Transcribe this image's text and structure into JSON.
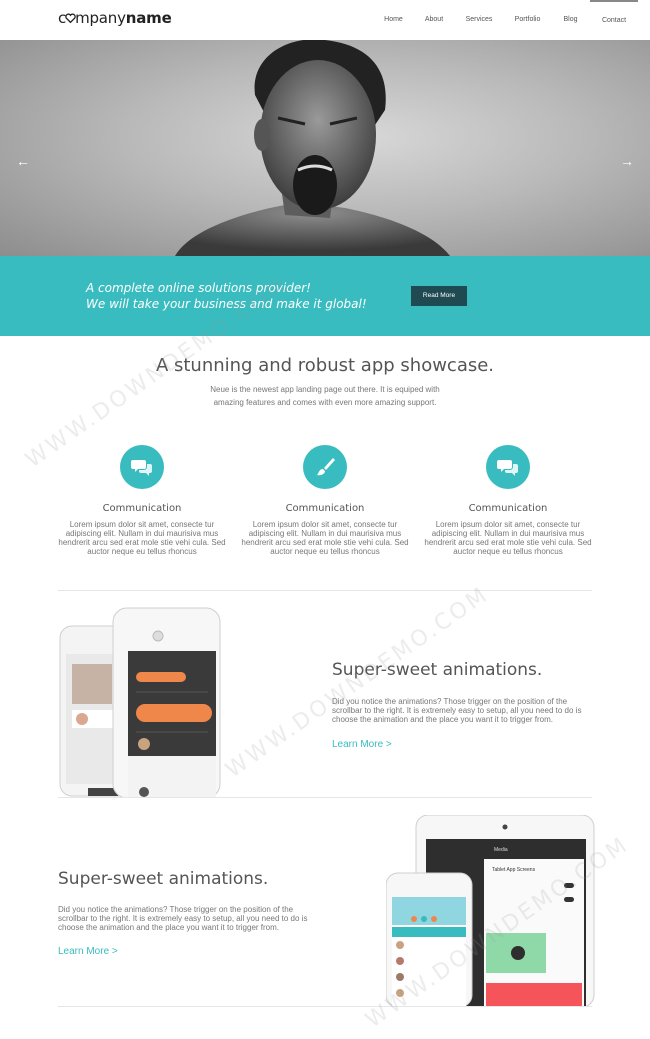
{
  "header": {
    "logo": {
      "prefix": "c",
      "middle": "mpany",
      "bold": "name"
    },
    "nav": [
      {
        "label": "Home"
      },
      {
        "label": "About"
      },
      {
        "label": "Services"
      },
      {
        "label": "Portfolio"
      },
      {
        "label": "Blog"
      },
      {
        "label": "Contact"
      }
    ]
  },
  "hero": {
    "prev_icon": "arrow-left-icon",
    "next_icon": "arrow-right-icon"
  },
  "banner": {
    "line1": "A complete online solutions provider!",
    "line2": "We will take your business and make it global!",
    "button": "Read More"
  },
  "showcase": {
    "title": "A stunning and robust app showcase.",
    "description": "Neue is the newest app landing page out there. It is equiped with amazing features and comes with even more amazing support."
  },
  "features": [
    {
      "icon": "chat-bubbles-icon",
      "title": "Communication",
      "text": "Lorem ipsum dolor sit amet, consecte tur adipiscing elit. Nullam in dui maurisiva mus hendrerit arcu sed erat mole stie vehi cula. Sed auctor neque eu tellus rhoncus"
    },
    {
      "icon": "paintbrush-icon",
      "title": "Communication",
      "text": "Lorem ipsum dolor sit amet, consecte tur adipiscing elit. Nullam in dui maurisiva mus hendrerit arcu sed erat mole stie vehi cula. Sed auctor neque eu tellus rhoncus"
    },
    {
      "icon": "chat-bubbles-icon",
      "title": "Communication",
      "text": "Lorem ipsum dolor sit amet, consecte tur adipiscing elit. Nullam in dui maurisiva mus hendrerit arcu sed erat mole stie vehi cula. Sed auctor neque eu tellus rhoncus"
    }
  ],
  "section_right": {
    "title": "Super-sweet animations.",
    "text": "Did you notice the animations? Those trigger on the position of the scrollbar to the right. It is extremely easy to setup, all you need to do is choose the animation and the place you want it to trigger from.",
    "link": "Learn More >"
  },
  "section_left": {
    "title": "Super-sweet animations.",
    "text": "Did you notice the animations? Those trigger on the position of the scrollbar to the right. It is extremely easy to setup, all you need to do is choose the animation and the place you want it to trigger from.",
    "link": "Learn More >"
  },
  "tablet_screen": {
    "title": "Tablet App Screens",
    "header": "Media"
  },
  "watermark": "WWW.DOWNDEMO.COM",
  "colors": {
    "accent": "#39bcbf",
    "button_dark": "#1f4a52",
    "orange": "#f0874a"
  }
}
